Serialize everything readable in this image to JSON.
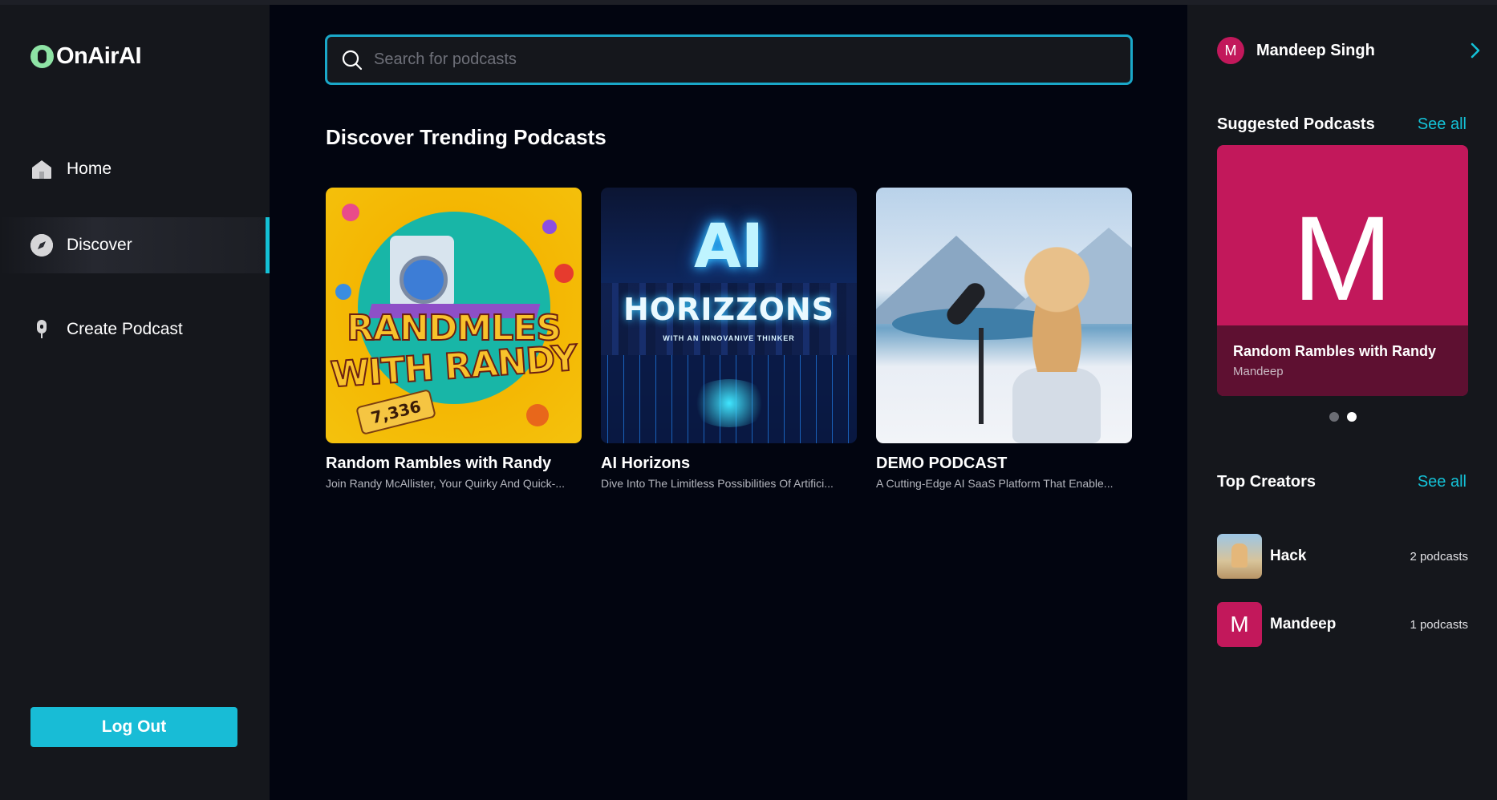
{
  "app": {
    "name": "OnAirAI"
  },
  "nav": {
    "items": [
      {
        "label": "Home",
        "icon": "home-icon"
      },
      {
        "label": "Discover",
        "icon": "compass-icon",
        "active": true
      },
      {
        "label": "Create Podcast",
        "icon": "microphone-icon"
      }
    ],
    "logout_label": "Log Out"
  },
  "search": {
    "placeholder": "Search for podcasts",
    "value": ""
  },
  "main": {
    "section_title": "Discover Trending Podcasts",
    "podcasts": [
      {
        "title": "Random Rambles with Randy",
        "description": "Join Randy McAllister, Your Quirky And Quick-...",
        "art_line1": "RANDMLES",
        "art_line2": "WITH RANDY",
        "art_tag": "7,336"
      },
      {
        "title": "AI Horizons",
        "description": "Dive Into The Limitless Possibilities Of Artifici...",
        "art_line1": "AI",
        "art_line2": "HORIZZONS",
        "art_sub": "WITH AN INNOVANIVE THINKER"
      },
      {
        "title": "DEMO PODCAST",
        "description": "A Cutting-Edge AI SaaS Platform That Enable..."
      }
    ]
  },
  "right": {
    "user": {
      "initial": "M",
      "name": "Mandeep Singh"
    },
    "suggested": {
      "heading": "Suggested Podcasts",
      "see_all": "See all",
      "card": {
        "letter": "M",
        "title": "Random Rambles with Randy",
        "author": "Mandeep"
      },
      "carousel": {
        "count": 2,
        "active_index": 1
      }
    },
    "top_creators": {
      "heading": "Top Creators",
      "see_all": "See all",
      "creators": [
        {
          "name": "Hack",
          "count": "2 podcasts"
        },
        {
          "name": "Mandeep",
          "initial": "M",
          "count": "1 podcasts"
        }
      ]
    }
  },
  "colors": {
    "accent": "#14c1d6",
    "avatar": "#c2185b",
    "logo": "#8ee3a5",
    "main_bg": "#020510",
    "sidebar_bg": "#15171c"
  }
}
